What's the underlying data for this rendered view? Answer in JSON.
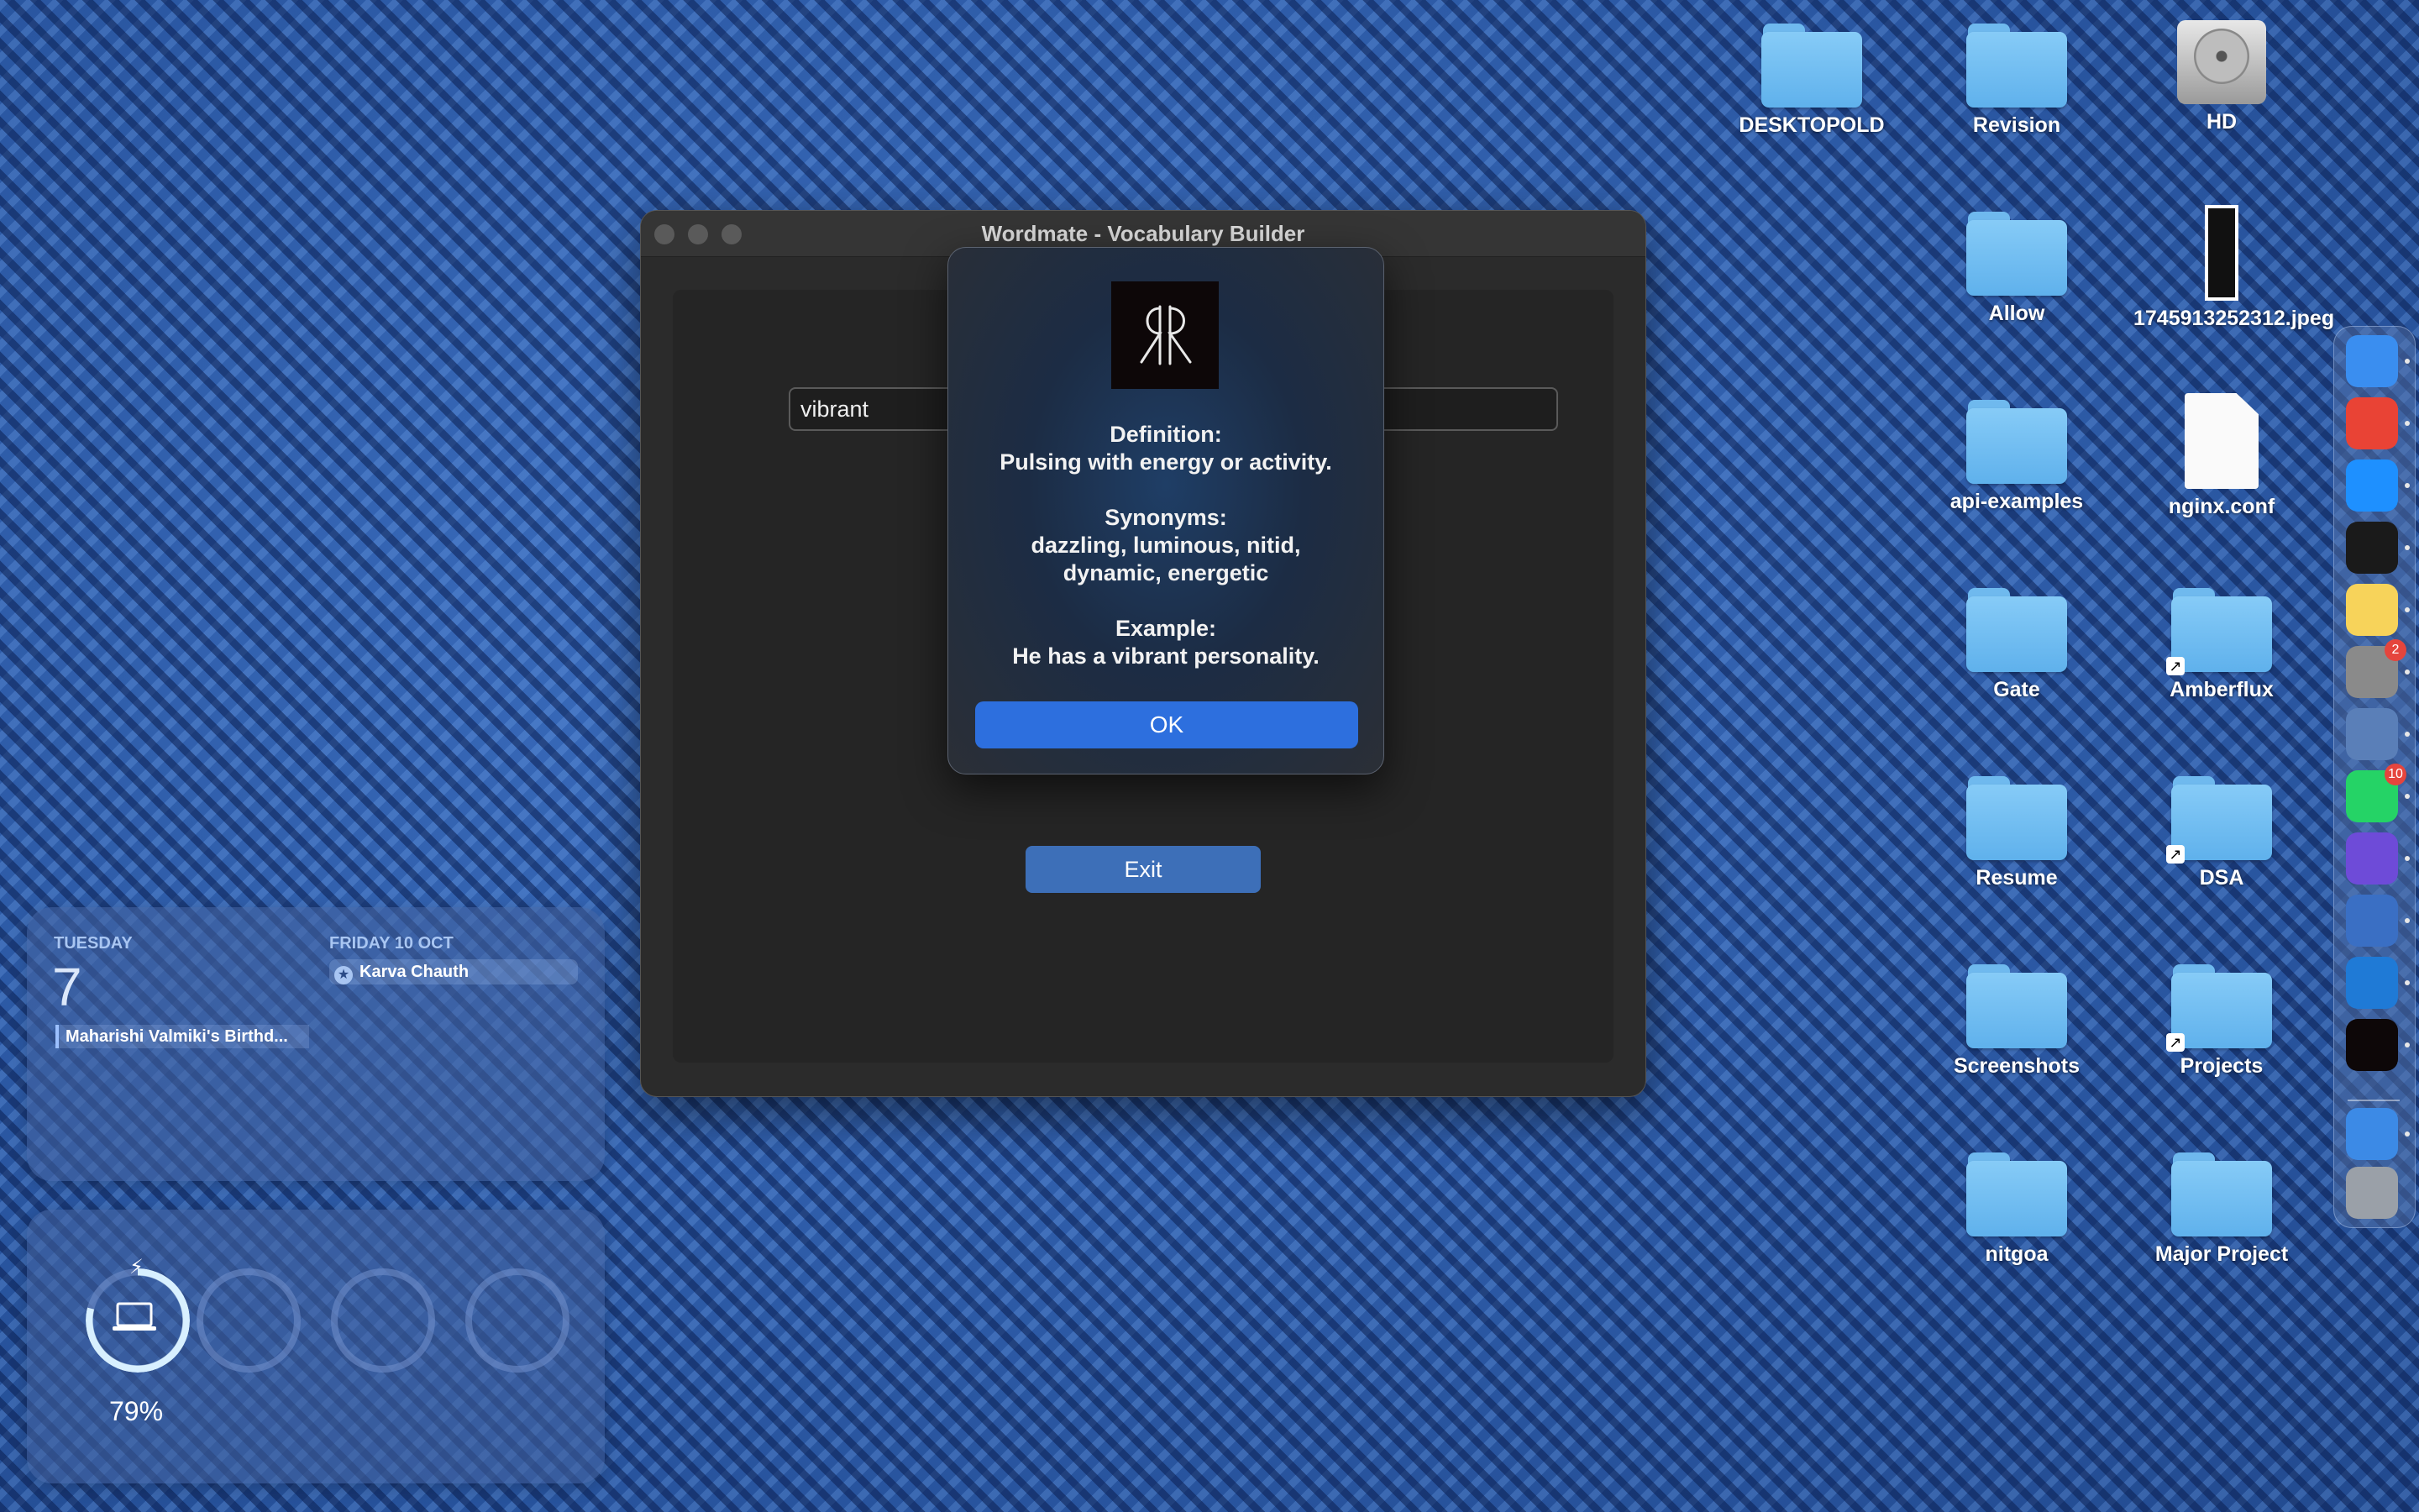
{
  "desktop": {
    "icons": [
      {
        "label": "DESKTOPOLD",
        "kind": "folder"
      },
      {
        "label": "Revision",
        "kind": "folder"
      },
      {
        "label": "HD",
        "kind": "hard-drive"
      },
      {
        "label": "Allow",
        "kind": "folder"
      },
      {
        "label": "1745913252312.jpeg",
        "kind": "image"
      },
      {
        "label": "api-examples",
        "kind": "folder"
      },
      {
        "label": "nginx.conf",
        "kind": "document"
      },
      {
        "label": "Gate",
        "kind": "folder"
      },
      {
        "label": "Amberflux",
        "kind": "folder-alias"
      },
      {
        "label": "Resume",
        "kind": "folder"
      },
      {
        "label": "DSA",
        "kind": "folder-alias"
      },
      {
        "label": "Screenshots",
        "kind": "folder"
      },
      {
        "label": "Projects",
        "kind": "folder-alias"
      },
      {
        "label": "nitgoa",
        "kind": "folder"
      },
      {
        "label": "Major Project",
        "kind": "folder"
      }
    ]
  },
  "window": {
    "title": "Wordmate - Vocabulary Builder",
    "input_value": "vibrant",
    "exit_label": "Exit"
  },
  "alert": {
    "logo_icon": "app-monogram-icon",
    "definition_heading": "Definition:",
    "definition_text": "Pulsing with energy or activity.",
    "synonyms_heading": "Synonyms:",
    "synonyms_line1": "dazzling, luminous, nitid,",
    "synonyms_line2": "dynamic, energetic",
    "example_heading": "Example:",
    "example_text": "He has a vibrant personality.",
    "ok_label": "OK"
  },
  "calendar_widget": {
    "day_name": "TUESDAY",
    "day_number": "7",
    "event_today": "Maharishi Valmiki's Birthd...",
    "upcoming_day": "FRIDAY 10 OCT",
    "event_upcoming": "Karva Chauth"
  },
  "battery_widget": {
    "percent": "79%",
    "level": 0.79
  },
  "dock": {
    "items": [
      {
        "name": "finder-icon",
        "color": "#3a8ef0"
      },
      {
        "name": "chrome-icon",
        "color": "#e94335"
      },
      {
        "name": "safari-icon",
        "color": "#1e90ff"
      },
      {
        "name": "terminal-icon",
        "color": "#1a1a1a"
      },
      {
        "name": "notes-icon",
        "color": "#f7d35a"
      },
      {
        "name": "system-settings-icon",
        "color": "#8a8a8a",
        "badge": "2"
      },
      {
        "name": "preview-icon",
        "color": "#5a7fb8"
      },
      {
        "name": "whatsapp-icon",
        "color": "#25d366",
        "badge": "10"
      },
      {
        "name": "obsidian-icon",
        "color": "#6e4bd8"
      },
      {
        "name": "swift-app-icon",
        "color": "#3a6fc4"
      },
      {
        "name": "vscode-icon",
        "color": "#1f7ad6"
      },
      {
        "name": "wordmate-icon",
        "color": "#0d0708"
      },
      {
        "name": "globe-icon",
        "color": "#3c8ae6"
      },
      {
        "name": "trash-icon",
        "color": "#9aa0a8"
      }
    ]
  }
}
